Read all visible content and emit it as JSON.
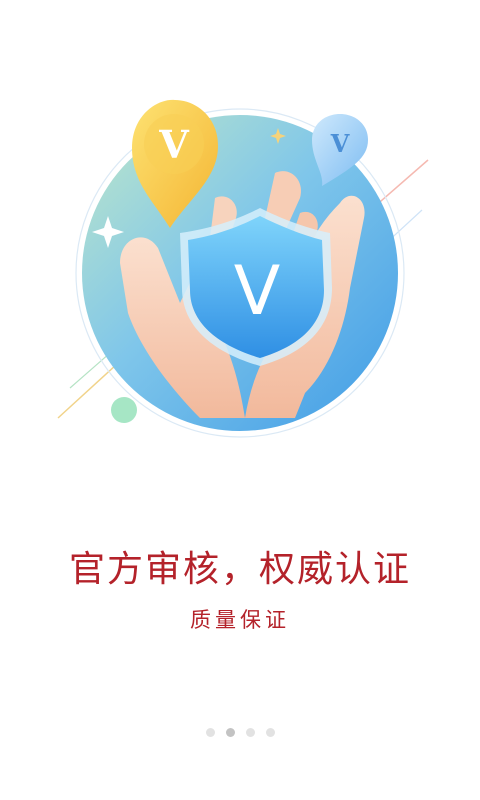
{
  "onboarding": {
    "headline": "官方审核，权威认证",
    "subline": "质量保证",
    "illustration": {
      "badge_letter": "V",
      "icons": [
        "hands-icon",
        "shield-icon",
        "location-pin-icon"
      ]
    },
    "pager": {
      "count": 4,
      "active_index": 1
    }
  },
  "colors": {
    "text_accent": "#b4222a",
    "dot_inactive": "#e2e2e2",
    "dot_active": "#c3c3c3",
    "shield": "#4aaef0",
    "pin_gold": "#f5c84a",
    "pin_blue": "#8fcaf5",
    "circle_bg": "#5fb5ea"
  }
}
